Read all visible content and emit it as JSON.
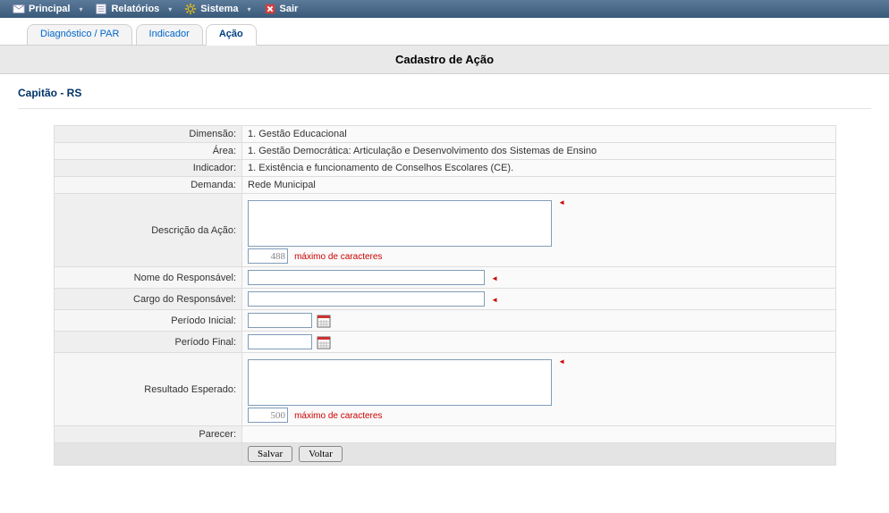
{
  "menubar": {
    "principal": "Principal",
    "relatorios": "Relatórios",
    "sistema": "Sistema",
    "sair": "Sair"
  },
  "tabs": {
    "diag": "Diagnóstico / PAR",
    "indicador": "Indicador",
    "acao": "Ação"
  },
  "page_title": "Cadastro de Ação",
  "context": "Capitão - RS",
  "labels": {
    "dimensao": "Dimensão:",
    "area": "Área:",
    "indicador": "Indicador:",
    "demanda": "Demanda:",
    "descricao": "Descrição da Ação:",
    "nome_resp": "Nome do Responsável:",
    "cargo_resp": "Cargo do Responsável:",
    "periodo_inicial": "Período Inicial:",
    "periodo_final": "Período Final:",
    "resultado": "Resultado Esperado:",
    "parecer": "Parecer:"
  },
  "values": {
    "dimensao": "1. Gestão Educacional",
    "area": "1. Gestão Democrática: Articulação e Desenvolvimento dos Sistemas de Ensino",
    "indicador": "1. Existência e funcionamento de Conselhos Escolares (CE).",
    "demanda": "Rede Municipal",
    "descricao": "",
    "nome_resp": "",
    "cargo_resp": "",
    "periodo_inicial": "",
    "periodo_final": "",
    "resultado": "",
    "parecer": ""
  },
  "counters": {
    "descricao": "488",
    "resultado": "500"
  },
  "hints": {
    "maxchars": "máximo de caracteres"
  },
  "buttons": {
    "salvar": "Salvar",
    "voltar": "Voltar"
  }
}
